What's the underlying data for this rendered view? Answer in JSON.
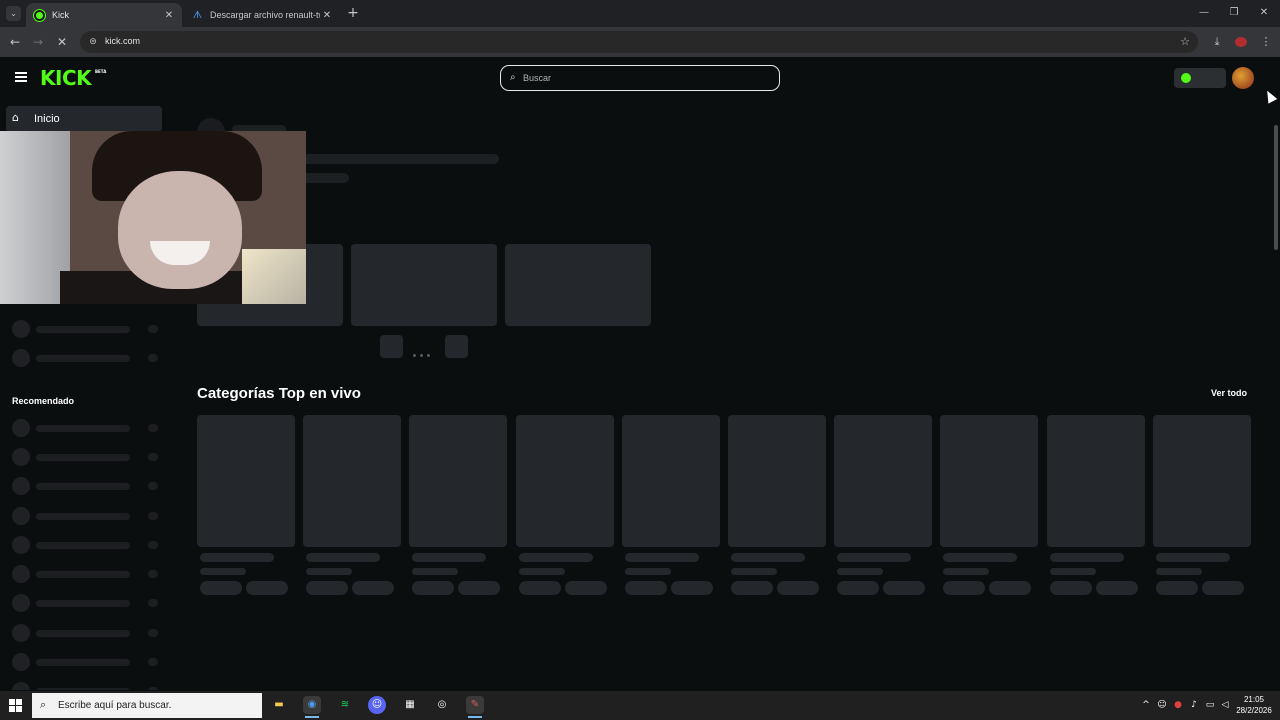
{
  "browser": {
    "tabs": [
      {
        "title": "Kick",
        "active": true,
        "favicon": "kick-favicon"
      },
      {
        "title": "Descargar archivo renault-twing",
        "active": false,
        "favicon": "mediafire-favicon"
      }
    ],
    "tab_close_glyph": "✕",
    "new_tab_glyph": "+",
    "tab_list_glyph": "⌄",
    "window_controls": {
      "minimize": "—",
      "restore": "❐",
      "close": "✕"
    },
    "nav": {
      "back": "←",
      "forward": "→",
      "stop": "✕"
    },
    "url": "kick.com",
    "site_info_glyph": "⊜",
    "bookmark_glyph": "☆",
    "download_glyph": "⤓",
    "menu_glyph": "⋮"
  },
  "kick": {
    "logo_text": "KICK",
    "logo_badge": "BETA",
    "brand_color": "#53fc18",
    "search_placeholder": "Buscar",
    "search_glyph": "⌕"
  },
  "sidebar": {
    "home_label": "Inicio",
    "home_glyph": "⌂",
    "section_recommended": "Recomendado"
  },
  "main": {
    "top_categories_heading": "Categorías Top en vivo",
    "see_all": "Ver todo"
  },
  "taskbar": {
    "search_placeholder": "Escribe aquí para buscar.",
    "search_glyph": "⌕",
    "apps": [
      {
        "name": "file-explorer",
        "glyph": "▬"
      },
      {
        "name": "chrome",
        "glyph": "◉"
      },
      {
        "name": "spotify",
        "glyph": "≋"
      },
      {
        "name": "discord",
        "glyph": "☺"
      },
      {
        "name": "store",
        "glyph": "▦"
      },
      {
        "name": "obs",
        "glyph": "◎"
      },
      {
        "name": "app",
        "glyph": "✎"
      }
    ],
    "tray_up": "^",
    "time": "21:05",
    "date": "28/2/2026"
  }
}
